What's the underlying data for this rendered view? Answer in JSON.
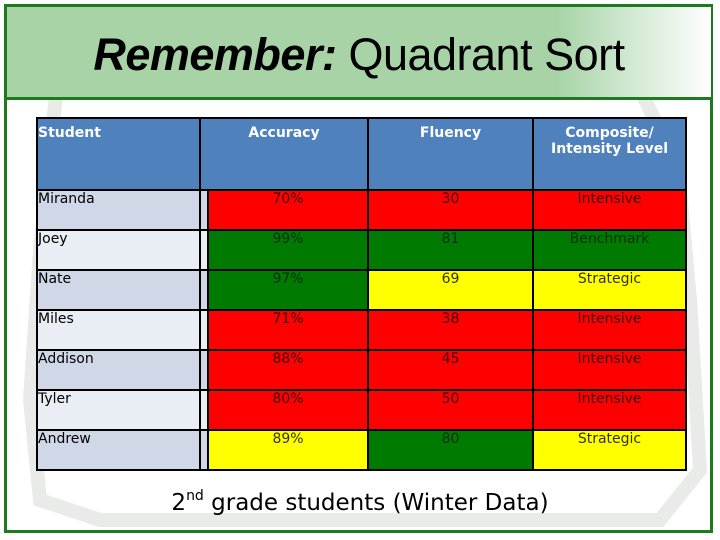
{
  "slide": {
    "title_emphasis": "Remember:",
    "title_rest": " Quadrant Sort",
    "caption_number": "2",
    "caption_superscript": "nd",
    "caption_rest": " grade students (Winter Data)"
  },
  "colors": {
    "frame_green": "#1e7a1e",
    "title_band": "#a7d3a7",
    "header_blue": "#4f81bd",
    "intensive_red": "#ff0000",
    "benchmark_green": "#007a00",
    "strategic_yellow": "#ffff00"
  },
  "table": {
    "headers": {
      "student": "Student",
      "accuracy": "Accuracy",
      "fluency": "Fluency",
      "composite_line1": "Composite/",
      "composite_line2": "Intensity Level"
    },
    "rows": [
      {
        "student": "Miranda",
        "accuracy": "70%",
        "accuracy_color": "red",
        "fluency": "30",
        "fluency_color": "red",
        "level": "Intensive",
        "level_color": "red"
      },
      {
        "student": "Joey",
        "accuracy": "99%",
        "accuracy_color": "green",
        "fluency": "81",
        "fluency_color": "green",
        "level": "Benchmark",
        "level_color": "green"
      },
      {
        "student": "Nate",
        "accuracy": "97%",
        "accuracy_color": "green",
        "fluency": "69",
        "fluency_color": "yellow",
        "level": "Strategic",
        "level_color": "yellow"
      },
      {
        "student": "Miles",
        "accuracy": "71%",
        "accuracy_color": "red",
        "fluency": "38",
        "fluency_color": "red",
        "level": "Intensive",
        "level_color": "red"
      },
      {
        "student": "Addison",
        "accuracy": "88%",
        "accuracy_color": "red",
        "fluency": "45",
        "fluency_color": "red",
        "level": "Intensive",
        "level_color": "red"
      },
      {
        "student": "Tyler",
        "accuracy": "80%",
        "accuracy_color": "red",
        "fluency": "50",
        "fluency_color": "red",
        "level": "Intensive",
        "level_color": "red"
      },
      {
        "student": "Andrew",
        "accuracy": "89%",
        "accuracy_color": "yellow",
        "fluency": "80",
        "fluency_color": "green",
        "level": "Strategic",
        "level_color": "yellow"
      }
    ]
  }
}
